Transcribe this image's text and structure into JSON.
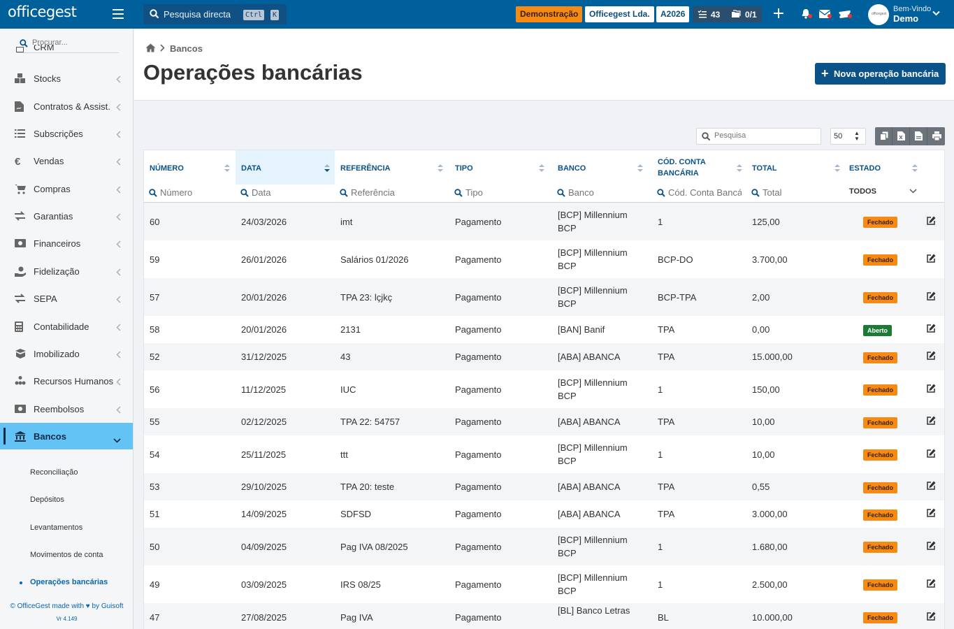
{
  "app": {
    "logo": "officegest",
    "search_placeholder": "Pesquisa directa",
    "kbd_ctrl": "Ctrl",
    "kbd_k": "K",
    "demo_badge": "Demonstração",
    "company": "Officegest Lda.",
    "year": "A2026",
    "tasks_count": "43",
    "docs_count": "0/1",
    "avatar_text": "officegest",
    "welcome": "Bem-Vindo",
    "user": "Demo",
    "brand_color": "#00609c",
    "accent_color": "#0a5288"
  },
  "sidebar": {
    "search_placeholder": "Procurar...",
    "partial_item": "CRM",
    "items": [
      {
        "label": "Stocks",
        "icon": "boxes-icon"
      },
      {
        "label": "Contratos & Assist.",
        "icon": "contract-icon"
      },
      {
        "label": "Subscrições",
        "icon": "list-icon"
      },
      {
        "label": "Vendas",
        "icon": "euro-icon"
      },
      {
        "label": "Compras",
        "icon": "cart-icon"
      },
      {
        "label": "Garantias",
        "icon": "exchange-icon"
      },
      {
        "label": "Financeiros",
        "icon": "money-icon"
      },
      {
        "label": "Fidelização",
        "icon": "hand-coin-icon"
      },
      {
        "label": "SEPA",
        "icon": "exchange-icon"
      },
      {
        "label": "Contabilidade",
        "icon": "calculator-icon"
      },
      {
        "label": "Imobilizado",
        "icon": "box-open-icon"
      },
      {
        "label": "Recursos Humanos",
        "icon": "org-chart-icon"
      },
      {
        "label": "Reembolsos",
        "icon": "money-icon"
      },
      {
        "label": "Bancos",
        "icon": "bank-icon"
      }
    ],
    "subitems": [
      "Reconciliação",
      "Depósitos",
      "Levantamentos",
      "Movimentos de conta",
      "Operações bancárias"
    ],
    "footer": "© OfficeGest made with ♥ by Guisoft",
    "version": "Vr 4.149"
  },
  "page": {
    "breadcrumb": "Bancos",
    "title": "Operações bancárias",
    "new_button": "Nova operação bancária"
  },
  "toolbar": {
    "search_placeholder": "Pesquisa",
    "page_size": "50"
  },
  "table": {
    "columns": [
      "NÚMERO",
      "DATA",
      "REFERÊNCIA",
      "TIPO",
      "BANCO",
      "CÓD. CONTA BANCÁRIA",
      "TOTAL",
      "ESTADO"
    ],
    "filters": [
      "Número",
      "Data",
      "Referência",
      "Tipo",
      "Banco",
      "Cód. Conta Bancá",
      "Total"
    ],
    "estado_filter": "TODOS",
    "rows": [
      {
        "numero": "60",
        "data": "24/03/2026",
        "referencia": "imt",
        "tipo": "Pagamento",
        "banco": "[BCP] Millennium BCP",
        "conta": "1",
        "total": "125,00",
        "estado": "Fechado"
      },
      {
        "numero": "59",
        "data": "26/01/2026",
        "referencia": "Salários 01/2026",
        "tipo": "Pagamento",
        "banco": "[BCP] Millennium BCP",
        "conta": "BCP-DO",
        "total": "3.700,00",
        "estado": "Fechado"
      },
      {
        "numero": "57",
        "data": "20/01/2026",
        "referencia": "TPA 23: lçjkç",
        "tipo": "Pagamento",
        "banco": "[BCP] Millennium BCP",
        "conta": "BCP-TPA",
        "total": "2,00",
        "estado": "Fechado"
      },
      {
        "numero": "58",
        "data": "20/01/2026",
        "referencia": "2131",
        "tipo": "Pagamento",
        "banco": "[BAN] Banif",
        "conta": "TPA",
        "total": "0,00",
        "estado": "Aberto"
      },
      {
        "numero": "52",
        "data": "31/12/2025",
        "referencia": "43",
        "tipo": "Pagamento",
        "banco": "[ABA] ABANCA",
        "conta": "TPA",
        "total": "15.000,00",
        "estado": "Fechado"
      },
      {
        "numero": "56",
        "data": "11/12/2025",
        "referencia": "IUC",
        "tipo": "Pagamento",
        "banco": "[BCP] Millennium BCP",
        "conta": "1",
        "total": "150,00",
        "estado": "Fechado"
      },
      {
        "numero": "55",
        "data": "02/12/2025",
        "referencia": "TPA 22: 54757",
        "tipo": "Pagamento",
        "banco": "[ABA] ABANCA",
        "conta": "TPA",
        "total": "10,00",
        "estado": "Fechado"
      },
      {
        "numero": "54",
        "data": "25/11/2025",
        "referencia": "ttt",
        "tipo": "Pagamento",
        "banco": "[BCP] Millennium BCP",
        "conta": "1",
        "total": "10,00",
        "estado": "Fechado"
      },
      {
        "numero": "53",
        "data": "29/10/2025",
        "referencia": "TPA 20: teste",
        "tipo": "Pagamento",
        "banco": "[ABA] ABANCA",
        "conta": "TPA",
        "total": "0,55",
        "estado": "Fechado"
      },
      {
        "numero": "51",
        "data": "14/09/2025",
        "referencia": "SDFSD",
        "tipo": "Pagamento",
        "banco": "[ABA] ABANCA",
        "conta": "TPA",
        "total": "3.000,00",
        "estado": "Fechado"
      },
      {
        "numero": "50",
        "data": "04/09/2025",
        "referencia": "Pag IVA 08/2025",
        "tipo": "Pagamento",
        "banco": "[BCP] Millennium BCP",
        "conta": "1",
        "total": "1.680,00",
        "estado": "Fechado"
      },
      {
        "numero": "49",
        "data": "03/09/2025",
        "referencia": "IRS 08/25",
        "tipo": "Pagamento",
        "banco": "[BCP] Millennium BCP",
        "conta": "1",
        "total": "2.500,00",
        "estado": "Fechado"
      },
      {
        "numero": "47",
        "data": "27/08/2025",
        "referencia": "Pag IVA",
        "tipo": "Pagamento",
        "banco": "[BL] Banco Letras",
        "conta": "BL",
        "total": "10.000,00",
        "estado": "Fechado"
      }
    ]
  }
}
